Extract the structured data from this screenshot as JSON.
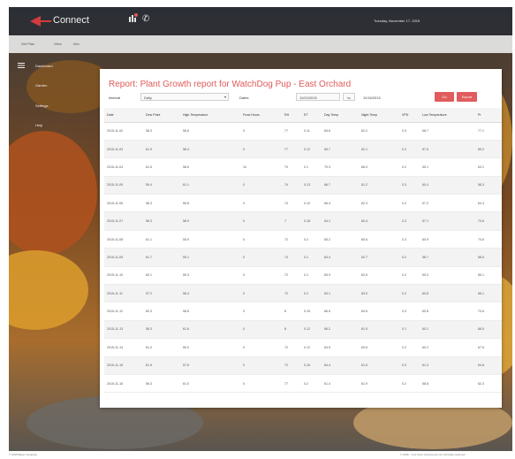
{
  "app": {
    "brand": "Connect",
    "date": "Tuesday, November 17, 2015"
  },
  "nav": {
    "items": [
      "Set Plan",
      "View",
      "Info"
    ]
  },
  "sidebar": {
    "items": [
      "Dashboard",
      "Garden",
      "Settings",
      "Help"
    ]
  },
  "report": {
    "title": "Report: Plant Growth report for WatchDog Pup - East Orchard",
    "interval_label": "Interval",
    "interval_value": "Daily",
    "dates_label": "Dates",
    "from_value": "11/02/2015",
    "to_label": "to",
    "to_value": "11/16/2015",
    "btn_one": "Go",
    "btn_two": "Export"
  },
  "table": {
    "columns": [
      "Date",
      "Dew Point",
      "High Temperature",
      "Frost Hours",
      "RH",
      "ET",
      "Day Temp",
      "Night Temp",
      "VPD",
      "Low Temperature",
      "Pr"
    ],
    "rows": [
      [
        "2015-11-02",
        "58.3",
        "58.8",
        "0",
        "77",
        "0.11",
        "65.6",
        "62.2",
        "0.3",
        "58.7",
        "77.1"
      ],
      [
        "2015-11-03",
        "61.9",
        "58.4",
        "0",
        "77",
        "0.12",
        "65.7",
        "62.1",
        "0.2",
        "57.5",
        "65.2"
      ],
      [
        "2015-11-04",
        "61.5",
        "58.6",
        "10",
        "70",
        "0.1",
        "70.3",
        "66.0",
        "0.2",
        "55.1",
        "63.1"
      ],
      [
        "2015-11-05",
        "59.4",
        "61.1",
        "0",
        "74",
        "0.13",
        "66.7",
        "61.2",
        "0.3",
        "60.4",
        "58.3"
      ],
      [
        "2015-11-06",
        "58.3",
        "59.8",
        "0",
        "74",
        "0.10",
        "66.4",
        "62.3",
        "0.2",
        "57.2",
        "64.3"
      ],
      [
        "2015-11-07",
        "56.3",
        "58.9",
        "0",
        "7",
        "0.18",
        "64.1",
        "60.4",
        "0.3",
        "57.1",
        "70.6"
      ],
      [
        "2015-11-08",
        "61.1",
        "55.9",
        "0",
        "72",
        "0.2",
        "65.2",
        "65.6",
        "0.3",
        "60.9",
        "70.6"
      ],
      [
        "2015-11-09",
        "61.7",
        "59.1",
        "0",
        "74",
        "0.1",
        "64.4",
        "62.7",
        "0.2",
        "56.7",
        "68.5"
      ],
      [
        "2015-11-10",
        "60.1",
        "55.3",
        "0",
        "72",
        "0.1",
        "65.9",
        "62.6",
        "0.2",
        "55.3",
        "65.1"
      ],
      [
        "2015-11-11",
        "57.2",
        "58.4",
        "0",
        "72",
        "0.2",
        "63.1",
        "63.0",
        "0.2",
        "60.8",
        "66.1"
      ],
      [
        "2015-11-12",
        "60.3",
        "58.8",
        "0",
        "8",
        "0.15",
        "66.5",
        "60.6",
        "0.3",
        "60.8",
        "70.6"
      ],
      [
        "2015-11-13",
        "58.3",
        "61.6",
        "0",
        "8",
        "0.12",
        "66.2",
        "61.5",
        "0.1",
        "60.1",
        "66.5"
      ],
      [
        "2015-11-14",
        "61.0",
        "59.0",
        "0",
        "72",
        "0.12",
        "64.5",
        "60.6",
        "0.2",
        "60.2",
        "67.6"
      ],
      [
        "2015-11-15",
        "61.9",
        "57.6",
        "0",
        "72",
        "0.16",
        "64.4",
        "61.6",
        "0.3",
        "61.3",
        "64.8"
      ],
      [
        "2015-11-16",
        "58.3",
        "61.0",
        "0",
        "77",
        "0.2",
        "61.4",
        "61.9",
        "0.2",
        "58.8",
        "62.3"
      ]
    ]
  },
  "footer": {
    "left": "© 2015 Bayer Company",
    "right": "© 2015 - Your Farm Instruments Ltd. All rights reserved"
  },
  "colors": {
    "accent": "#e05a5a",
    "topbar": "#2c3038"
  }
}
